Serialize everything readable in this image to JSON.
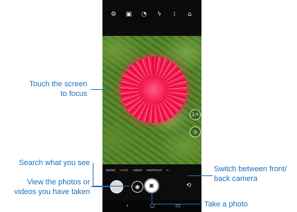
{
  "top_bar": {
    "icons": [
      "gear-icon",
      "aspect-ratio-icon",
      "timer-icon",
      "flash-icon",
      "more-options-icon",
      "home-icon"
    ]
  },
  "viewfinder": {
    "subject": "red-pom-pom-flower"
  },
  "modes": {
    "items": [
      "MORE",
      "AUTO",
      "VIDEO",
      "PORTRAIT",
      "A"
    ],
    "selected": "AUTO"
  },
  "callouts": {
    "touch_focus_line1": "Touch the screen",
    "touch_focus_line2": "to focus",
    "search_label": "Search what you see",
    "gallery_line1": "View the photos or",
    "gallery_line2": "videos you have taken",
    "switch_line1": "Switch between front/",
    "switch_line2": "back camera",
    "take_photo": "Take a photo"
  },
  "nav": {
    "back": "‹",
    "home": "○",
    "recents": "▭"
  },
  "colors": {
    "callout_text": "#1c6fb8",
    "active_mode": "#f0a23a"
  }
}
